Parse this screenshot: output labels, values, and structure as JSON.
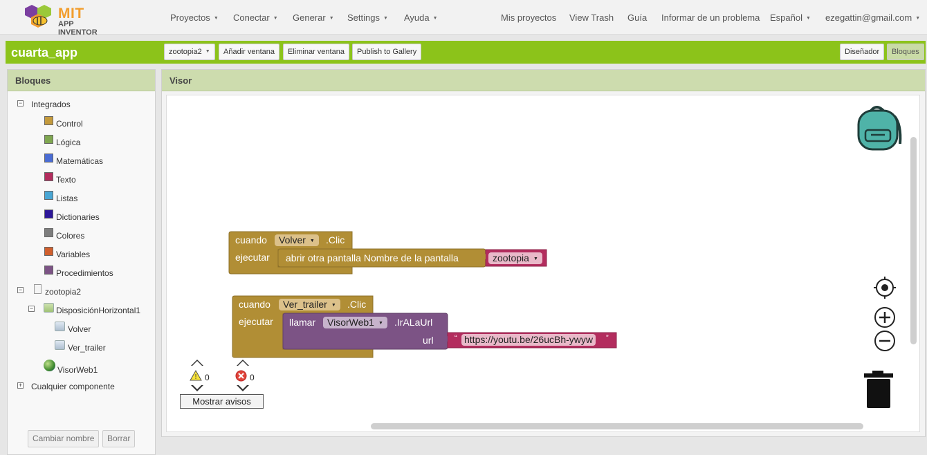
{
  "app": {
    "brand_top": "MIT",
    "brand_bottom": "APP INVENTOR"
  },
  "nav": {
    "menus": [
      "Proyectos",
      "Conectar",
      "Generar",
      "Settings",
      "Ayuda"
    ],
    "links": [
      "Mis proyectos",
      "View Trash",
      "Guía",
      "Informar de un problema"
    ],
    "language": "Español",
    "user": "ezegattin@gmail.com"
  },
  "project": {
    "name": "cuarta_app",
    "screen_select": "zootopia2",
    "add_screen": "Añadir ventana",
    "remove_screen": "Eliminar ventana",
    "publish": "Publish to Gallery",
    "designer": "Diseñador",
    "blocks": "Bloques"
  },
  "blocks_panel": {
    "title": "Bloques",
    "builtin": "Integrados",
    "categories": [
      {
        "label": "Control",
        "color": "#c49a3c"
      },
      {
        "label": "Lógica",
        "color": "#7fa750"
      },
      {
        "label": "Matemáticas",
        "color": "#4a6cd4"
      },
      {
        "label": "Texto",
        "color": "#b32d5e"
      },
      {
        "label": "Listas",
        "color": "#49a6d4"
      },
      {
        "label": "Dictionaries",
        "color": "#2d1799"
      },
      {
        "label": "Colores",
        "color": "#7d7d7d"
      },
      {
        "label": "Variables",
        "color": "#d05f2d"
      },
      {
        "label": "Procedimientos",
        "color": "#7c5385"
      }
    ],
    "screen": "zootopia2",
    "arrangement": "DisposiciónHorizontal1",
    "buttons": [
      "Volver",
      "Ver_trailer"
    ],
    "webviewer": "VisorWeb1",
    "any_component": "Cualquier componente",
    "rename": "Cambiar nombre",
    "delete": "Borrar"
  },
  "viewer": {
    "title": "Visor",
    "event1": {
      "when": "cuando",
      "component": "Volver",
      "event": ".Clic",
      "do": "ejecutar",
      "action": "abrir otra pantalla  Nombre de la pantalla",
      "screen_value": "zootopia"
    },
    "event2": {
      "when": "cuando",
      "component": "Ver_trailer",
      "event": ".Clic",
      "do": "ejecutar",
      "call": "llamar",
      "call_component": "VisorWeb1",
      "method": ".IrALaUrl",
      "param": "url",
      "url_value": "https://youtu.be/26ucBh-ywyw"
    },
    "warnings_count": "0",
    "errors_count": "0",
    "show_warnings": "Mostrar avisos"
  }
}
